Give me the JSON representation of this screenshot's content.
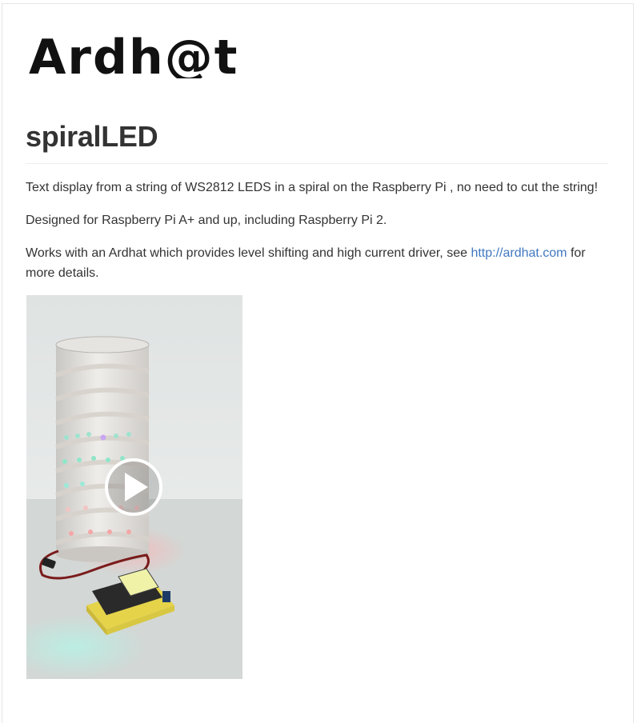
{
  "logo": {
    "text": "Ardh@t"
  },
  "page": {
    "title": "spiralLED"
  },
  "content": {
    "p1": "Text display from a string of WS2812 LEDS in a spiral on the Raspberry Pi , no need to cut the string!",
    "p2": "Designed for Raspberry Pi A+ and up, including Raspberry Pi 2.",
    "p3_before": "Works with an Ardhat which provides level shifting and high current driver, see ",
    "p3_link": "http://ardhat.com",
    "p3_after": " for more details."
  },
  "video": {
    "play_icon": "play-icon"
  },
  "colors": {
    "link": "#4078c0",
    "text": "#333333",
    "logo": "#111111"
  }
}
